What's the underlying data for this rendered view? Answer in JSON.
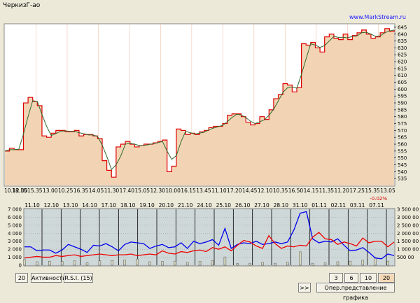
{
  "window": {
    "title": "ЧеркизГ-ао",
    "site": "www.MarkStream.ru"
  },
  "colors": {
    "bg": "#ece9d8",
    "area_fill": "#f2d4b4",
    "price": "#dd0000",
    "ma": "#2f6b2f",
    "lower_bg": "#cfd8d8",
    "blue_series": "#0000ee",
    "red_series": "#ee0000",
    "volume_bar": "#d8d8c0"
  },
  "price_chart": {
    "y_ticks": [
      "645",
      "640",
      "635",
      "630",
      "625",
      "620",
      "615",
      "610",
      "605",
      "600",
      "595",
      "590",
      "585",
      "580",
      "575",
      "570",
      "565",
      "560",
      "555",
      "550",
      "545",
      "540",
      "535"
    ],
    "x_labels": [
      "10.12.00",
      "18.15",
      "15.35",
      "13.00",
      "10.25",
      "16.35",
      "14.05",
      "11.30",
      "17.40",
      "15.05",
      "12.30",
      "10.00",
      "16.15",
      "13.45",
      "11.10",
      "17.20",
      "14.45",
      "12.10",
      "10.35",
      "16.50",
      "14.15",
      "11.35",
      "11.20",
      "17.25",
      "15.35",
      "13.05"
    ],
    "change": "-0.02%",
    "chart_data": {
      "type": "line",
      "ylim": [
        530,
        647
      ],
      "series": [
        {
          "values": [
            555,
            557,
            556,
            556,
            590,
            594,
            591,
            588,
            566,
            565,
            568,
            570,
            570,
            569,
            569,
            570,
            566,
            567,
            567,
            566,
            564,
            548,
            541,
            536,
            558,
            560,
            562,
            560,
            558,
            559,
            560,
            560,
            561,
            562,
            563,
            540,
            544,
            571,
            570,
            567,
            568,
            567,
            569,
            570,
            572,
            573,
            573,
            575,
            581,
            582,
            582,
            580,
            576,
            574,
            575,
            580,
            578,
            585,
            593,
            596,
            604,
            603,
            598,
            601,
            633,
            632,
            634,
            630,
            627,
            638,
            640,
            637,
            636,
            640,
            636,
            639,
            641,
            643,
            640,
            637,
            638,
            641,
            644,
            642,
            643
          ]
        }
      ]
    }
  },
  "indicator_chart": {
    "date_labels": [
      "11.10",
      "12.10",
      "13.10",
      "14.10",
      "17.10",
      "18.10",
      "19.10",
      "20.10",
      "21.10",
      "24.10",
      "25.10",
      "26.10",
      "27.10",
      "28.10",
      "31.10",
      "01.11",
      "02.11",
      "03.11",
      "07.11"
    ],
    "left_ticks": [
      "7 000",
      "6 000",
      "5 000",
      "4 000",
      "3 000",
      "2 000",
      "1 000",
      "0"
    ],
    "right_ticks": [
      "3 500 00",
      "3 000 00",
      "2 500 00",
      "2 000 00",
      "1 500 00",
      "1 000 00",
      "500 00"
    ],
    "chart_data": {
      "type": "line",
      "left_ylim": [
        0,
        7000
      ],
      "right_ylim": [
        0,
        3500000
      ],
      "series": [
        {
          "values": [
            2300,
            2300,
            1800,
            1900,
            1900,
            1500,
            1900,
            2600,
            2300,
            2000,
            1600,
            2500,
            2400,
            2700,
            2300,
            1800,
            2600,
            2900,
            2800,
            2700,
            2100,
            2400,
            2600,
            2200,
            2300,
            2800,
            2100,
            3000,
            2700,
            2900,
            3200,
            2500,
            4600,
            2100,
            2600,
            2800,
            2700,
            3000,
            2600,
            2700,
            2900,
            2700,
            2900,
            4400,
            6500,
            6700,
            3300,
            2800,
            3000,
            2900,
            3300,
            2500,
            1800,
            1900,
            2200,
            1600,
            900,
            800,
            1400,
            1200
          ]
        },
        {
          "values": [
            900,
            1000,
            1100,
            1000,
            1000,
            1200,
            1100,
            1200,
            1300,
            1100,
            1200,
            1300,
            1400,
            1300,
            1200,
            1300,
            1300,
            1400,
            1200,
            1300,
            1400,
            1300,
            1800,
            1500,
            1400,
            1700,
            1600,
            1800,
            1900,
            1700,
            2200,
            2000,
            2300,
            1800,
            2500,
            3100,
            2900,
            2400,
            2100,
            3700,
            2700,
            2100,
            2400,
            2300,
            2500,
            2400,
            3500,
            4100,
            3300,
            3200,
            2600,
            2900,
            2700,
            2400,
            3400,
            2800,
            3000,
            3000,
            2300,
            2900
          ]
        }
      ]
    }
  },
  "toolbar": {
    "period_value": "20",
    "activity": "Активность",
    "rsi": "R.S.I. (15)",
    "scroll": ">>",
    "ranges": [
      "3 дн.",
      "6 дн.",
      "10 дн.",
      "20 дн."
    ],
    "active_range": "20 дн.",
    "op_button": "Опер.представление графика"
  }
}
